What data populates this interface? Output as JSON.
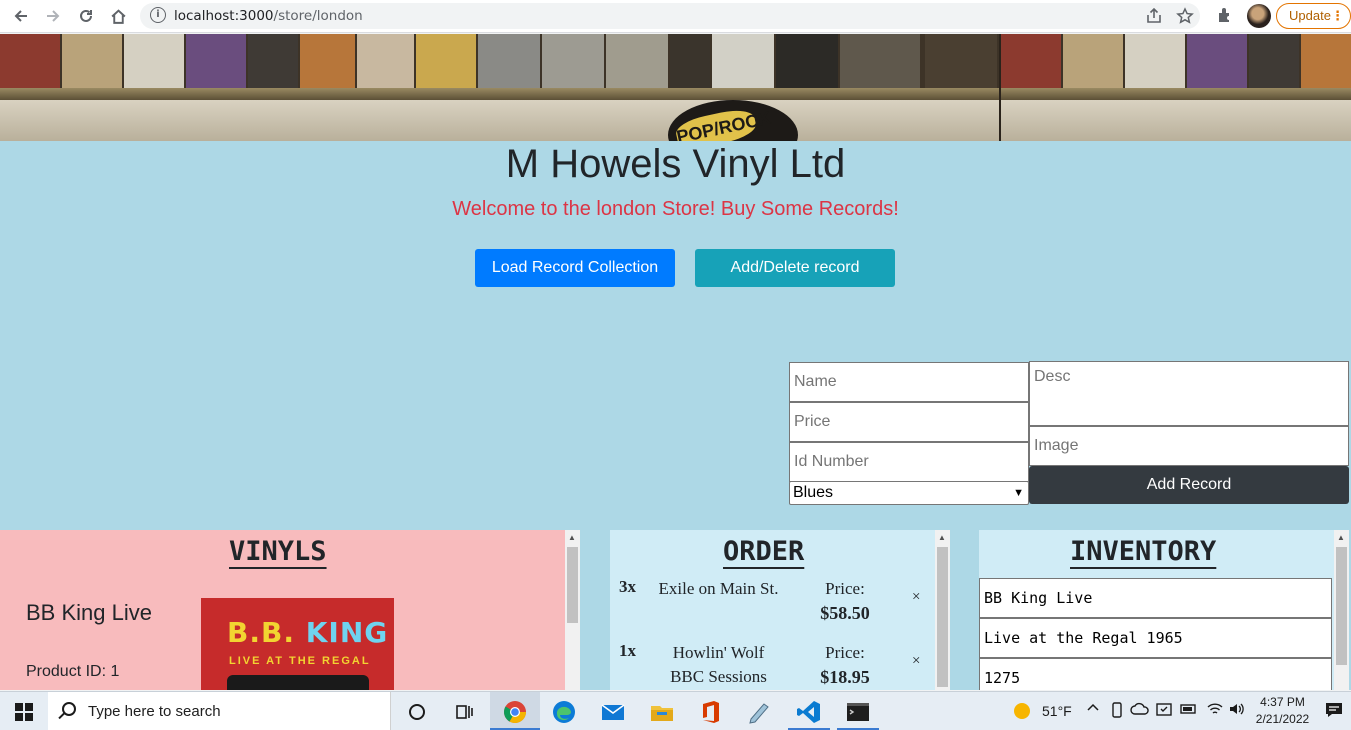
{
  "browser": {
    "url_host": "localhost:3000",
    "url_path": "/store/london",
    "update_label": "Update"
  },
  "page": {
    "title": "M Howels Vinyl Ltd",
    "welcome": "Welcome to the london Store! Buy Some Records!",
    "load_button": "Load Record Collection",
    "add_delete_button": "Add/Delete record",
    "banner_label": "POP/ROCK"
  },
  "form": {
    "name_placeholder": "Name",
    "price_placeholder": "Price",
    "id_placeholder": "Id Number",
    "desc_placeholder": "Desc",
    "image_placeholder": "Image",
    "genre_selected": "Blues",
    "add_record_button": "Add Record"
  },
  "vinyls": {
    "heading": "VINYLS",
    "items": [
      {
        "name": "BB King Live",
        "product_id": "Product ID: 1",
        "cover_title_a": "B.B.",
        "cover_title_b": "KING",
        "cover_subtitle": "LIVE AT THE REGAL"
      }
    ]
  },
  "order": {
    "heading": "ORDER",
    "items": [
      {
        "qty": "3x",
        "name": "Exile on Main St.",
        "price_label": "Price:",
        "price": "$58.50",
        "remove": "×"
      },
      {
        "qty": "1x",
        "name": "Howlin' Wolf BBC Sessions",
        "price_label": "Price:",
        "price": "$18.95",
        "remove": "×"
      }
    ]
  },
  "inventory": {
    "heading": "INVENTORY",
    "fields": [
      "BB King Live",
      "Live at the Regal 1965",
      "1275"
    ]
  },
  "taskbar": {
    "search_placeholder": "Type here to search",
    "weather": "51°F",
    "time": "4:37 PM",
    "date": "2/21/2022"
  },
  "colors": {
    "page_bg": "#add8e6",
    "primary": "#007bff",
    "info": "#17a2b8",
    "dark": "#343a40",
    "welcome": "#dc3545",
    "vinyls_bg": "#f8bbbd",
    "order_bg": "#d0ecf6"
  }
}
